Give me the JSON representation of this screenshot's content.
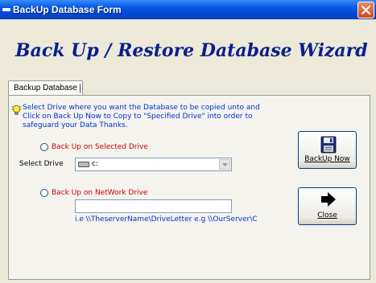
{
  "window": {
    "title": "BackUp Database Form"
  },
  "heading": "Back Up / Restore Database Wizard",
  "tab": {
    "label": "Backup Database"
  },
  "info": {
    "text": "Select Drive where you want the Database to be copied unto and Click on Back Up Now to Copy to \"Specified Drive\" into order to safeguard your Data Thanks."
  },
  "options": {
    "selected_drive_label": "Back Up on Selected Drive",
    "network_drive_label": "Back Up on NetWork Drive"
  },
  "drive": {
    "label": "Select Drive",
    "value": "c:"
  },
  "network": {
    "value": "",
    "hint": "i.e \\\\TheserverName\\DriveLetter e.g \\\\OurServer\\C"
  },
  "buttons": {
    "backup": "BackUp Now",
    "close": "Close"
  },
  "colors": {
    "titlebar": "#0A5BE0",
    "heading": "#0A1E8C",
    "info_text": "#0033CC",
    "radio_label": "#CC0000",
    "face": "#ECE9D8"
  },
  "icons": {
    "titlebar": "app-icon",
    "close": "close-icon",
    "info": "lightbulb-icon",
    "drive": "hard-drive-icon",
    "dropdown": "chevron-down-icon",
    "backup": "floppy-disk-icon",
    "close_button": "arrow-right-icon"
  }
}
